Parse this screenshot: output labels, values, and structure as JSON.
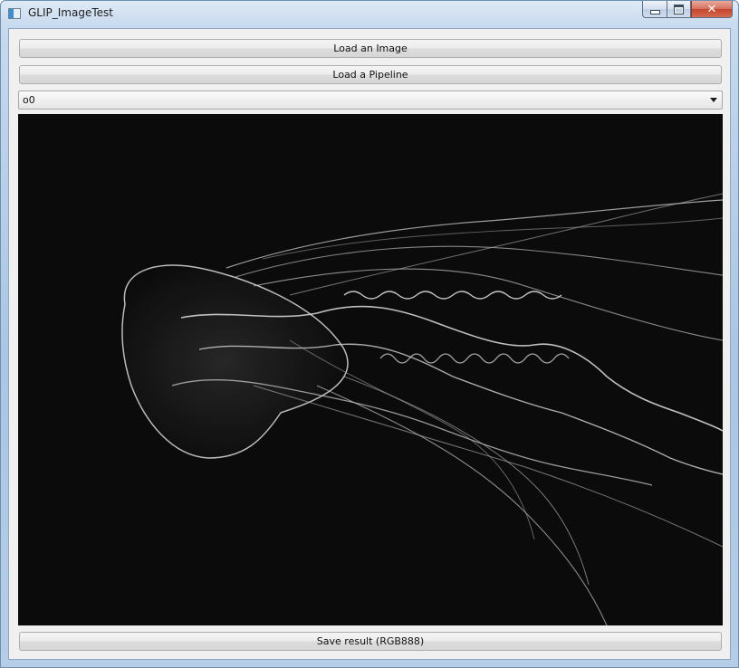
{
  "window": {
    "title": "GLIP_ImageTest",
    "close_glyph": "✕"
  },
  "toolbar": {
    "load_image_label": "Load an Image",
    "load_pipeline_label": "Load a Pipeline"
  },
  "output_select": {
    "selected": "o0"
  },
  "footer": {
    "save_label": "Save result (RGB888)"
  },
  "icons": {
    "app": "app-window-icon",
    "minimize": "minimize-icon",
    "maximize": "maximize-icon",
    "close": "close-icon",
    "dropdown": "chevron-down-icon"
  },
  "colors": {
    "viewer_background": "#0a0a0a",
    "edge_stroke": "#d8d8d8"
  }
}
